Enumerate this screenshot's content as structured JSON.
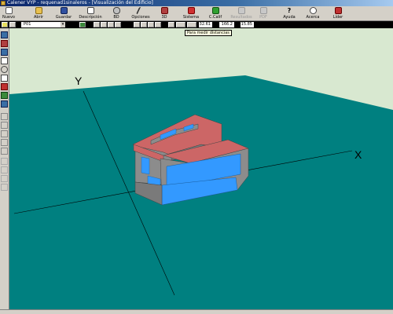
{
  "window": {
    "title": "Calener VYP - requenad1sinaleros - [Visualización del Edificio]"
  },
  "toolbar": {
    "items": [
      {
        "label": "Nuevo",
        "icon": "new-file-icon",
        "enabled": true
      },
      {
        "label": "Abrir",
        "icon": "open-folder-icon",
        "enabled": true
      },
      {
        "label": "Guardar",
        "icon": "save-icon",
        "enabled": true
      },
      {
        "label": "Descripción",
        "icon": "description-icon",
        "enabled": true
      },
      {
        "label": "BD",
        "icon": "database-icon",
        "enabled": true
      },
      {
        "label": "Opciones",
        "icon": "options-icon",
        "enabled": true
      },
      {
        "label": "3D",
        "icon": "3d-icon",
        "enabled": true
      },
      {
        "label": "Sistema",
        "icon": "system-icon",
        "enabled": true
      },
      {
        "label": "C.Calif",
        "icon": "calc-rating-icon",
        "enabled": true
      },
      {
        "label": "Resultados",
        "icon": "results-icon",
        "enabled": false
      },
      {
        "label": "PDF",
        "icon": "pdf-icon",
        "enabled": false
      },
      {
        "label": "Ayuda",
        "icon": "help-icon",
        "enabled": true
      },
      {
        "label": "Acerca",
        "icon": "about-icon",
        "enabled": true
      },
      {
        "label": "Líder",
        "icon": "lider-icon",
        "enabled": true
      }
    ]
  },
  "toolbar2": {
    "layer_value": "P01",
    "coord_x": "32.61",
    "coord_y": "166.2",
    "coord_z": "15.85"
  },
  "tooltip": {
    "text": "Para medir distancias"
  },
  "viewport": {
    "axis_x_label": "X",
    "axis_y_label": "Y"
  },
  "colors": {
    "background": "#d8e8d0",
    "ground": "#008080",
    "roof": "#cc6666",
    "wall": "#8c8c8c",
    "window": "#3399ff"
  }
}
